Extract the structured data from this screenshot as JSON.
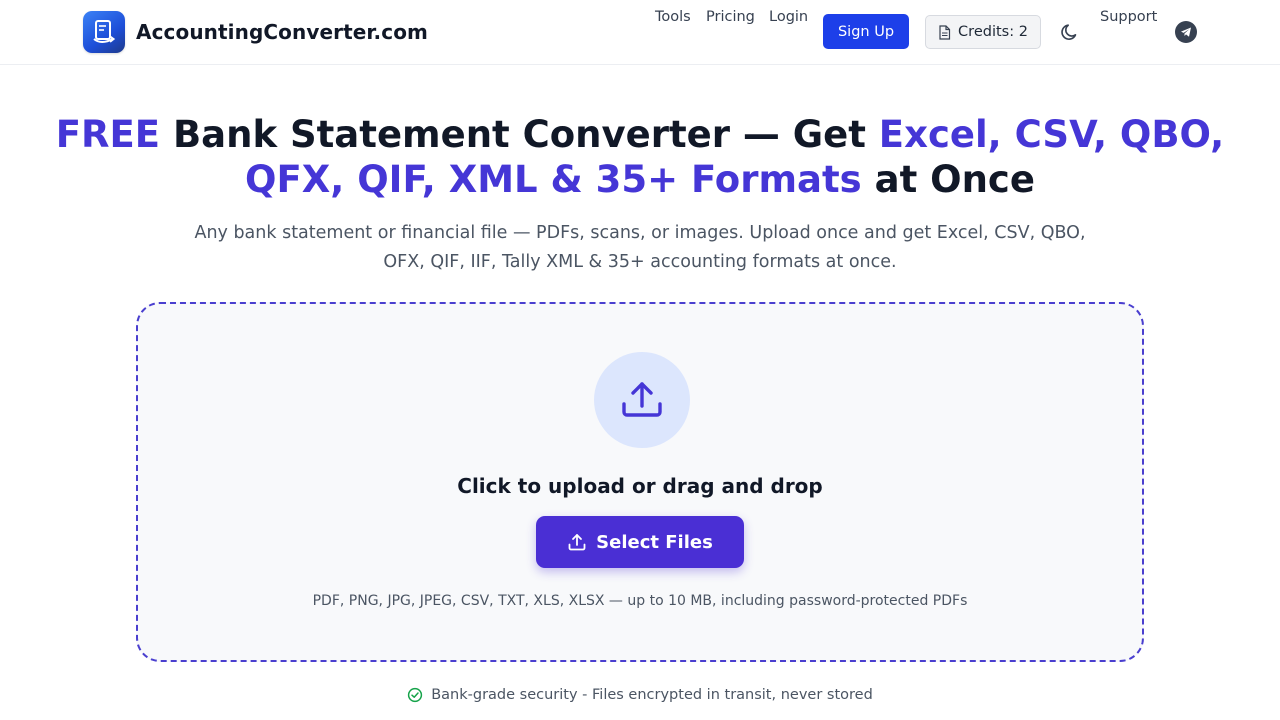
{
  "brand": {
    "name": "AccountingConverter.com",
    "logo_icon": "document-convert-icon"
  },
  "nav": {
    "tools": "Tools",
    "pricing": "Pricing",
    "login": "Login",
    "signup": "Sign Up",
    "credits": "Credits: 2",
    "support": "Support",
    "theme_icon": "moon-icon",
    "social_icon": "telegram-icon"
  },
  "hero": {
    "title_parts": [
      {
        "text": "FREE",
        "accent": true
      },
      {
        "text": " Bank Statement Converter — Get ",
        "accent": false
      },
      {
        "text": "Excel, CSV, QBO, QFX, QIF, XML & 35+ Formats",
        "accent": true
      },
      {
        "text": " at Once",
        "accent": false
      }
    ],
    "subtitle": "Any bank statement or financial file — PDFs, scans, or images. Upload once and get Excel, CSV, QBO, OFX, QIF, IIF, Tally XML & 35+ accounting formats at once."
  },
  "dropzone": {
    "title": "Click to upload or drag and drop",
    "button_label": "Select Files",
    "formats": "PDF, PNG, JPG, JPEG, CSV, TXT, XLS, XLSX — up to 10 MB, including password-protected PDFs"
  },
  "security": {
    "text": "Bank-grade security - Files encrypted in transit, never stored"
  },
  "colors": {
    "accent": "#4536d6",
    "primary_button": "#1d3fe9",
    "select_button": "#4a2fd4",
    "success": "#16a34a"
  }
}
